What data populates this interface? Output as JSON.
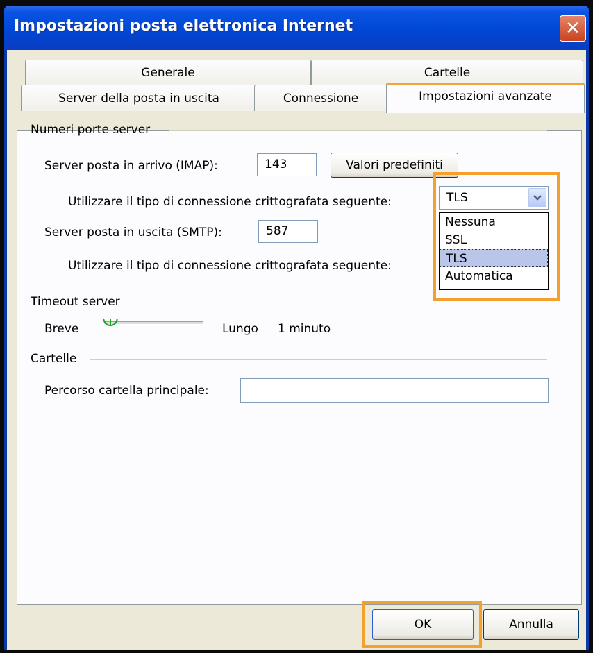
{
  "window": {
    "title": "Impostazioni posta elettronica Internet"
  },
  "tabs": {
    "back": [
      "Generale",
      "Cartelle"
    ],
    "front": [
      "Server della posta in uscita",
      "Connessione",
      "Impostazioni avanzate"
    ]
  },
  "ports": {
    "group_label": "Numeri porte server",
    "incoming_label": "Server posta in arrivo (IMAP):",
    "incoming_value": "143",
    "defaults_button": "Valori predefiniti",
    "encryption_label_1": "Utilizzare il tipo di connessione crittografata seguente:",
    "encryption_value": "TLS",
    "outgoing_label": "Server posta in uscita (SMTP):",
    "outgoing_value": "587",
    "encryption_label_2": "Utilizzare il tipo di connessione crittografata seguente:",
    "options": [
      "Nessuna",
      "SSL",
      "TLS",
      "Automatica"
    ],
    "selected_option": "TLS"
  },
  "timeout": {
    "group_label": "Timeout server",
    "short_label": "Breve",
    "long_label": "Lungo",
    "value_text": "1 minuto"
  },
  "folders": {
    "group_label": "Cartelle",
    "root_path_label": "Percorso cartella principale:",
    "root_path_value": ""
  },
  "footer": {
    "ok_label": "OK",
    "cancel_label": "Annulla"
  },
  "colors": {
    "highlight": "#f4a02c",
    "titlebar": "#0047d6",
    "tab_active_top": "#f3a33c"
  }
}
